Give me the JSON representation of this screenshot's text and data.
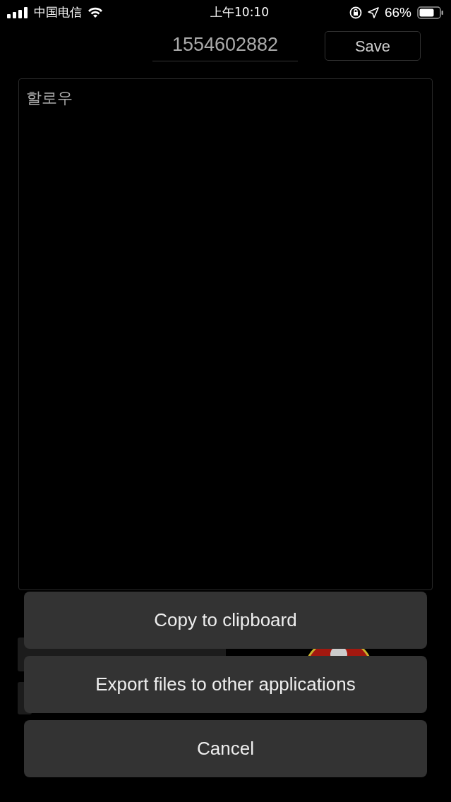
{
  "status_bar": {
    "carrier": "中国电信",
    "time": "上午10:10",
    "battery": "66%"
  },
  "header": {
    "title_field": {
      "value": "1554602882"
    },
    "save_button": "Save"
  },
  "editor": {
    "value": "할로우"
  },
  "action_sheet": {
    "actions": [
      "Copy to clipboard",
      "Export files to other applications"
    ],
    "cancel": "Cancel"
  }
}
